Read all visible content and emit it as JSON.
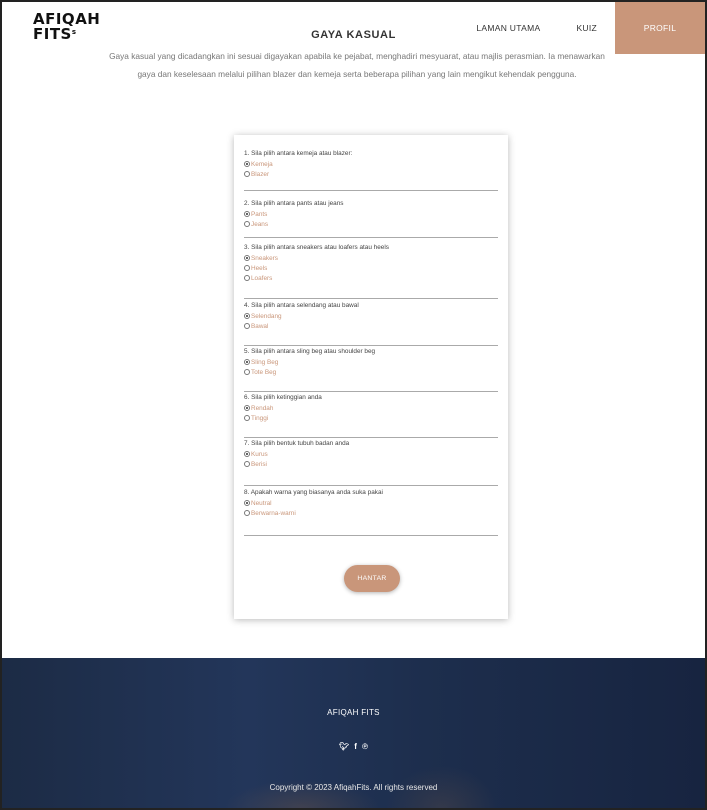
{
  "header": {
    "logo_line1": "AFIQAH",
    "logo_line2": "FITS",
    "logo_mark": "s",
    "nav": [
      {
        "label": "LAMAN UTAMA"
      },
      {
        "label": "KUIZ"
      },
      {
        "label": "PROFIL"
      }
    ]
  },
  "page": {
    "title": "GAYA KASUAL",
    "intro_line1": "Gaya kasual yang dicadangkan ini sesuai digayakan apabila ke pejabat, menghadiri mesyuarat, atau majlis perasmian. Ia menawarkan",
    "intro_line2": "gaya dan keselesaan melalui pilihan blazer dan kemeja serta beberapa pilihan yang lain mengikut kehendak pengguna."
  },
  "quiz": {
    "questions": [
      {
        "text": "1. Sila pilih antara kemeja atau blazer:",
        "options": [
          "Kemeja",
          "Blazer"
        ],
        "selected": 0
      },
      {
        "text": "2. Sila pilih antara pants atau jeans",
        "options": [
          "Pants",
          "Jeans"
        ],
        "selected": 0
      },
      {
        "text": "3. Sila pilih antara sneakers atau loafers atau heels",
        "options": [
          "Sneakers",
          "Heels",
          "Loafers"
        ],
        "selected": 0
      },
      {
        "text": "4. Sila pilih antara selendang atau bawal",
        "options": [
          "Selendang",
          "Bawal"
        ],
        "selected": 0
      },
      {
        "text": "5. Sila pilih antara sling beg atau shoulder beg",
        "options": [
          "Sling Beg",
          "Tote Beg"
        ],
        "selected": 0
      },
      {
        "text": "6. Sila pilih ketinggian anda",
        "options": [
          "Rendah",
          "Tinggi"
        ],
        "selected": 0
      },
      {
        "text": "7. Sila pilih bentuk tubuh badan anda",
        "options": [
          "Kurus",
          "Berisi"
        ],
        "selected": 0
      },
      {
        "text": "8. Apakah warna yang biasanya anda suka pakai",
        "options": [
          "Neutral",
          "Berwarna-warni"
        ],
        "selected": 0
      }
    ],
    "submit_label": "HANTAR"
  },
  "footer": {
    "brand": "AFIQAH FITS",
    "social_icons": [
      "twitter-icon",
      "facebook-icon",
      "pinterest-icon"
    ],
    "copyright": "Copyright © 2023 AfiqahFits. All rights reserved"
  },
  "colors": {
    "accent": "#c9967a",
    "footer_bg": "#1f2f4f"
  }
}
